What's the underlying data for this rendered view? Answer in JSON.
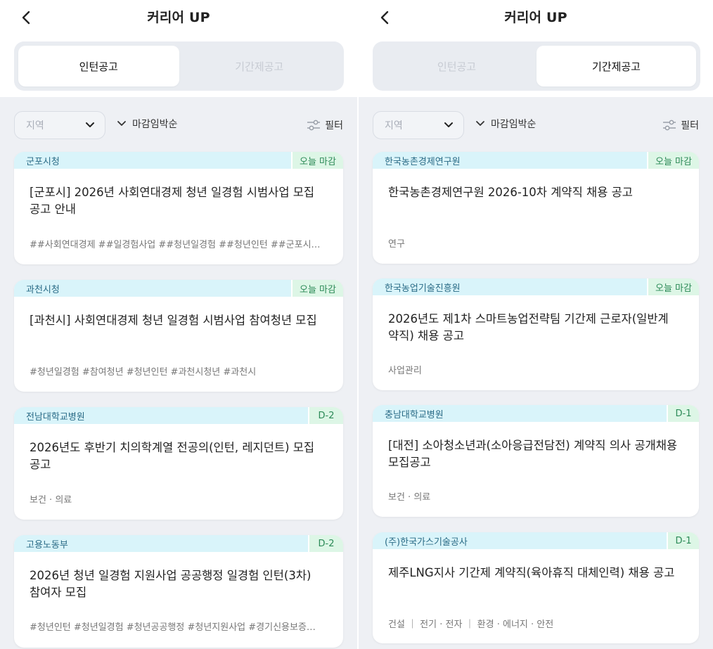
{
  "left": {
    "title": "커리어 UP",
    "tabs": [
      "인턴공고",
      "기간제공고"
    ],
    "filters": {
      "region": "지역",
      "sort": "마감임박순",
      "filter": "필터"
    },
    "cards": [
      {
        "org": "군포시청",
        "badge": "오늘 마감",
        "title": "[군포시] 2026년 사회연대경제 청년 일경험 시범사업 모집 공고 안내",
        "tags": "##사회연대경제 ##일경험사업 ##청년일경험 ##청년인턴 ##군포시…"
      },
      {
        "org": "과천시청",
        "badge": "오늘 마감",
        "title": "[과천시] 사회연대경제 청년 일경험 시범사업 참여청년 모집",
        "tags": "#청년일경험 #참여청년 #청년인턴 #과천시청년 #과천시"
      },
      {
        "org": "전남대학교병원",
        "badge": "D-2",
        "title": "2026년도 후반기 치의학계열 전공의(인턴, 레지던트) 모집 공고",
        "tags": "보건 · 의료"
      },
      {
        "org": "고용노동부",
        "badge": "D-2",
        "title": "2026년 청년 일경험 지원사업 공공행정 일경험 인턴(3차) 참여자 모집",
        "tags": "#청년인턴 #청년일경험 #청년공공행정 #청년지원사업 #경기신용보증재…"
      }
    ]
  },
  "right": {
    "title": "커리어 UP",
    "tabs": [
      "인턴공고",
      "기간제공고"
    ],
    "filters": {
      "region": "지역",
      "sort": "마감임박순",
      "filter": "필터"
    },
    "cards": [
      {
        "org": "한국농촌경제연구원",
        "badge": "오늘 마감",
        "title": "한국농촌경제연구원 2026-10차 계약직 채용 공고",
        "tags": "연구"
      },
      {
        "org": "한국농업기술진흥원",
        "badge": "오늘 마감",
        "title": "2026년도 제1차 스마트농업전략팀 기간제 근로자(일반계약직) 채용 공고",
        "tags": "사업관리"
      },
      {
        "org": "충남대학교병원",
        "badge": "D-1",
        "title": "[대전] 소아청소년과(소아응급전담전) 계약직 의사 공개채용 모집공고",
        "tags": "보건 · 의료"
      },
      {
        "org": "(주)한국가스기술공사",
        "badge": "D-1",
        "title": "제주LNG지사 기간제 계약직(육아휴직 대체인력) 채용 공고",
        "tags": "건설 ｜ 전기 · 전자 ｜ 환경 · 에너지 · 안전"
      }
    ]
  }
}
